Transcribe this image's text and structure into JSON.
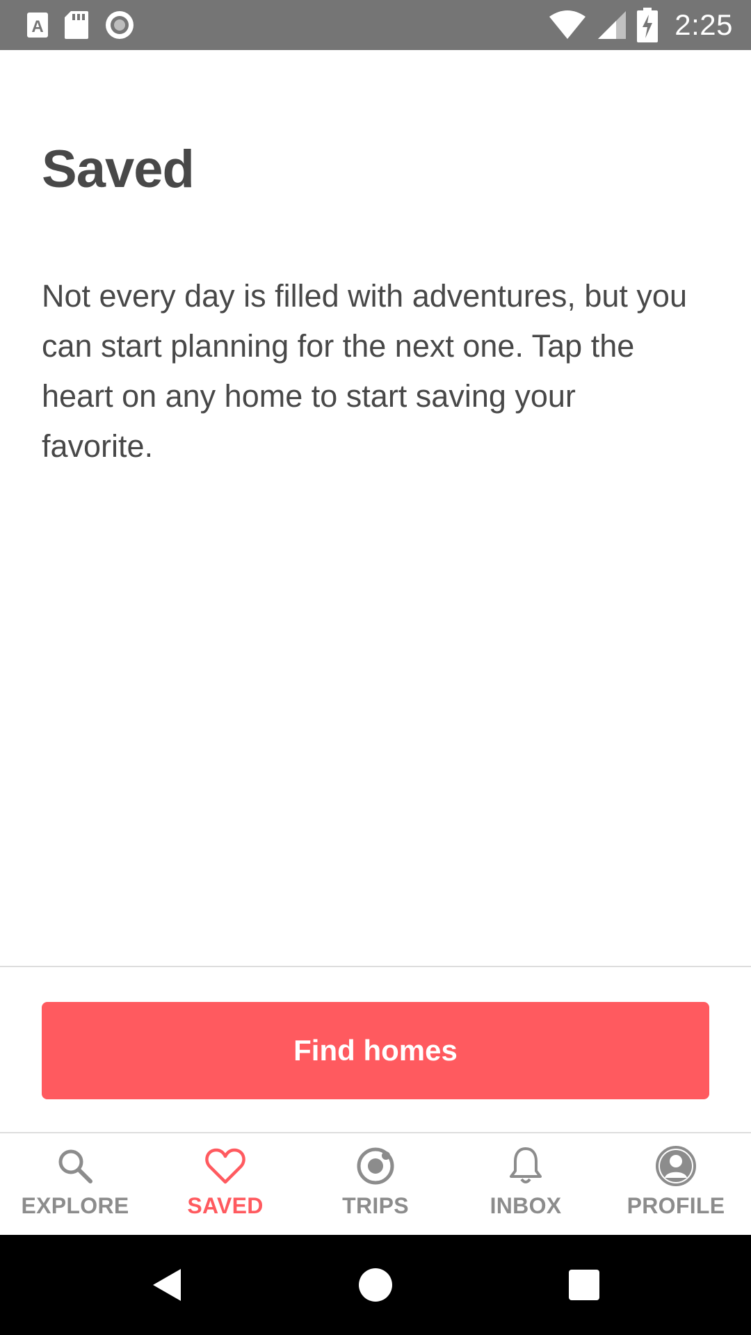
{
  "status_bar": {
    "time": "2:25",
    "left_icons": [
      "text-a-icon",
      "sd-card-icon",
      "record-icon"
    ],
    "right_icons": [
      "wifi-icon",
      "cell-signal-icon",
      "battery-charging-icon"
    ]
  },
  "main": {
    "title": "Saved",
    "body": "Not every day is filled with adventures, but you can start planning for the next one. Tap the heart on any home to start saving your favorite."
  },
  "action": {
    "find_homes_label": "Find homes"
  },
  "tabs": [
    {
      "label": "EXPLORE",
      "icon": "search-icon",
      "active": false
    },
    {
      "label": "SAVED",
      "icon": "heart-icon",
      "active": true
    },
    {
      "label": "TRIPS",
      "icon": "trips-icon",
      "active": false
    },
    {
      "label": "INBOX",
      "icon": "bell-icon",
      "active": false
    },
    {
      "label": "PROFILE",
      "icon": "profile-icon",
      "active": false
    }
  ],
  "colors": {
    "accent": "#FF5A5F",
    "text_primary": "#484848",
    "tab_inactive": "#8C8C8C",
    "status_bar": "#757575",
    "nav_bar": "#000000"
  },
  "system_nav": [
    "back-icon",
    "home-icon",
    "recents-icon"
  ]
}
